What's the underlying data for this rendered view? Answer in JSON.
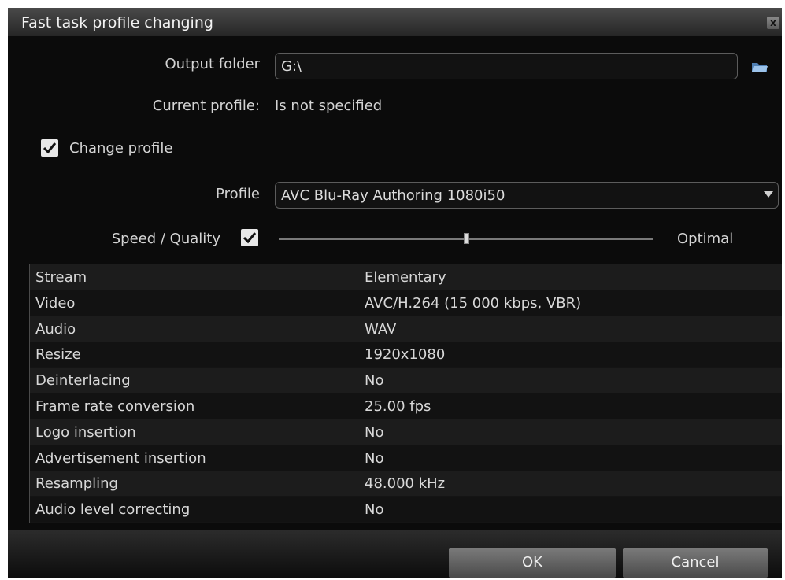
{
  "window": {
    "title": "Fast task profile changing",
    "close_glyph": "x"
  },
  "output_folder": {
    "label": "Output folder",
    "value": "G:\\",
    "browse_icon": "folder-open-icon"
  },
  "current_profile": {
    "label": "Current profile:",
    "value": "Is not specified"
  },
  "change_profile": {
    "label": "Change profile",
    "checked": true
  },
  "profile": {
    "label": "Profile",
    "selected": "AVC Blu-Ray Authoring 1080i50"
  },
  "speed_quality": {
    "label": "Speed / Quality",
    "checked": true,
    "level": 0.5,
    "value_label": "Optimal"
  },
  "table": {
    "rows": [
      [
        "Stream",
        "Elementary"
      ],
      [
        "Video",
        "AVC/H.264 (15 000 kbps, VBR)"
      ],
      [
        "Audio",
        "WAV"
      ],
      [
        "Resize",
        "1920x1080"
      ],
      [
        "Deinterlacing",
        "No"
      ],
      [
        "Frame rate conversion",
        "25.00 fps"
      ],
      [
        "Logo insertion",
        "No"
      ],
      [
        "Advertisement insertion",
        "No"
      ],
      [
        "Resampling",
        "48.000 kHz"
      ],
      [
        "Audio level correcting",
        "No"
      ]
    ]
  },
  "buttons": {
    "ok": "OK",
    "cancel": "Cancel"
  },
  "colors": {
    "background": "#0b0b0b",
    "text": "#d4d4d4",
    "accent_button": "#6a6a6a"
  }
}
